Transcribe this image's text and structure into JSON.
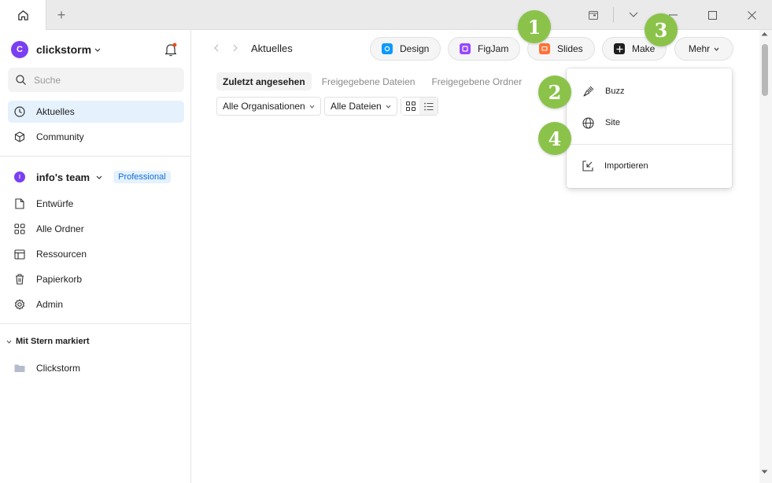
{
  "titlebar": {
    "new_tab": "+"
  },
  "sidebar": {
    "org": {
      "avatar_letter": "C",
      "name": "clickstorm"
    },
    "search_placeholder": "Suche",
    "nav": [
      {
        "label": "Aktuelles",
        "icon": "clock-icon",
        "active": true
      },
      {
        "label": "Community",
        "icon": "community-icon",
        "active": false
      }
    ],
    "team": {
      "avatar_letter": "I",
      "name": "info's team",
      "badge": "Professional"
    },
    "team_items": [
      {
        "label": "Entwürfe",
        "icon": "file-icon"
      },
      {
        "label": "Alle Ordner",
        "icon": "grid-icon"
      },
      {
        "label": "Ressourcen",
        "icon": "resources-icon"
      },
      {
        "label": "Papierkorb",
        "icon": "trash-icon"
      },
      {
        "label": "Admin",
        "icon": "gear-icon"
      }
    ],
    "starred": {
      "label": "Mit Stern markiert",
      "items": [
        {
          "label": "Clickstorm",
          "icon": "folder-icon"
        }
      ]
    }
  },
  "main": {
    "title": "Aktuelles",
    "create_buttons": [
      {
        "label": "Design",
        "color": "#0d99ff"
      },
      {
        "label": "FigJam",
        "color": "#9747ff"
      },
      {
        "label": "Slides",
        "color": "#ff7237"
      },
      {
        "label": "Make",
        "color": "#1e1e1e"
      },
      {
        "label": "Mehr"
      }
    ],
    "tabs": [
      {
        "label": "Zuletzt angesehen",
        "active": true
      },
      {
        "label": "Freigegebene Dateien",
        "active": false
      },
      {
        "label": "Freigegebene Ordner",
        "active": false
      }
    ],
    "filters": {
      "org": "Alle Organisationen",
      "files": "Alle Dateien"
    }
  },
  "dropdown": {
    "items": [
      {
        "label": "Buzz",
        "icon": "buzz-icon"
      },
      {
        "label": "Site",
        "icon": "globe-icon"
      },
      {
        "label": "Importieren",
        "icon": "import-icon"
      }
    ]
  },
  "markers": [
    "1",
    "2",
    "3",
    "4"
  ],
  "colors": {
    "accent": "#0d99ff",
    "active_bg": "#e5f1fd",
    "marker": "#8bc34a",
    "avatar": "#7b3ff2"
  }
}
